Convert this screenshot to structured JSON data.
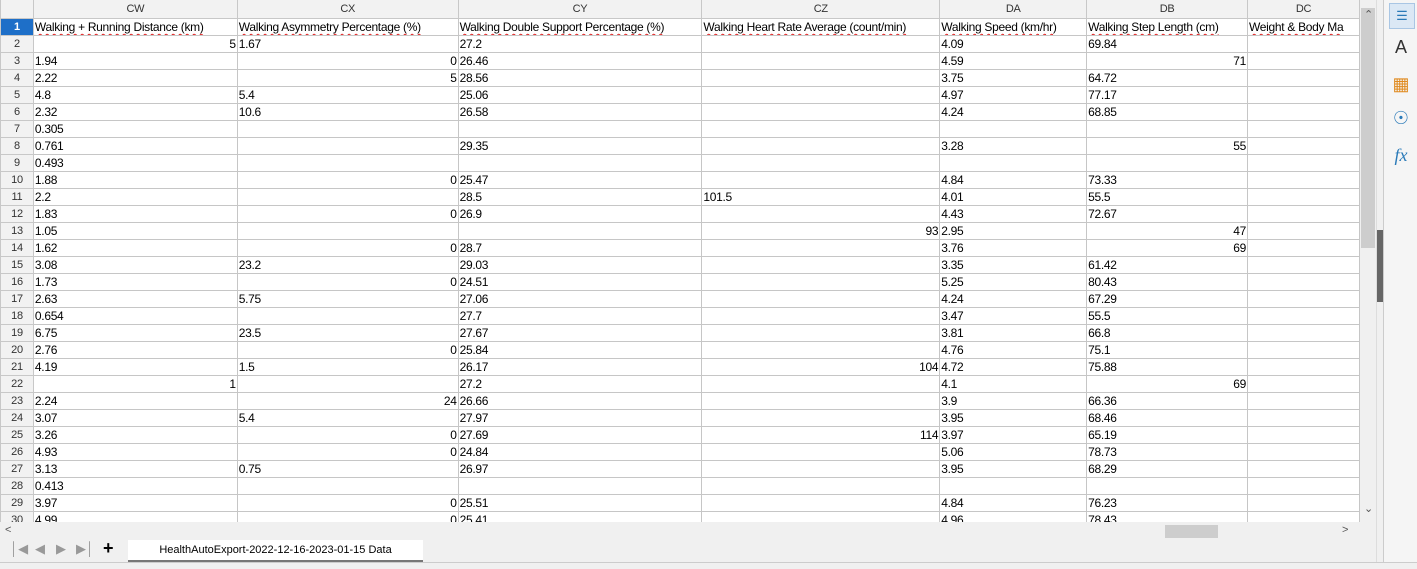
{
  "columns": [
    "CW",
    "CX",
    "CY",
    "CZ",
    "DA",
    "DB",
    "DC"
  ],
  "header_row": [
    "Walking + Running Distance (km)",
    "Walking Asymmetry Percentage (%)",
    "Walking Double Support Percentage (%)",
    "Walking Heart Rate Average (count/min)",
    "Walking Speed (km/hr)",
    "Walking Step Length (cm)",
    "Weight & Body Ma"
  ],
  "rows": [
    [
      5,
      "1.67",
      "27.2",
      "",
      "4.09",
      "69.84",
      ""
    ],
    [
      "1.94",
      0,
      "26.46",
      "",
      "4.59",
      71,
      ""
    ],
    [
      "2.22",
      5,
      "28.56",
      "",
      "3.75",
      "64.72",
      ""
    ],
    [
      "4.8",
      "5.4",
      "25.06",
      "",
      "4.97",
      "77.17",
      ""
    ],
    [
      "2.32",
      "10.6",
      "26.58",
      "",
      "4.24",
      "68.85",
      ""
    ],
    [
      "0.305",
      "",
      "",
      "",
      "",
      "",
      ""
    ],
    [
      "0.761",
      "",
      "29.35",
      "",
      "3.28",
      55,
      ""
    ],
    [
      "0.493",
      "",
      "",
      "",
      "",
      "",
      ""
    ],
    [
      "1.88",
      0,
      "25.47",
      "",
      "4.84",
      "73.33",
      ""
    ],
    [
      "2.2",
      "",
      "28.5",
      "101.5",
      "4.01",
      "55.5",
      ""
    ],
    [
      "1.83",
      0,
      "26.9",
      "",
      "4.43",
      "72.67",
      ""
    ],
    [
      "1.05",
      "",
      "",
      93,
      "2.95",
      47,
      ""
    ],
    [
      "1.62",
      0,
      "28.7",
      "",
      "3.76",
      69,
      ""
    ],
    [
      "3.08",
      "23.2",
      "29.03",
      "",
      "3.35",
      "61.42",
      ""
    ],
    [
      "1.73",
      0,
      "24.51",
      "",
      "5.25",
      "80.43",
      ""
    ],
    [
      "2.63",
      "5.75",
      "27.06",
      "",
      "4.24",
      "67.29",
      ""
    ],
    [
      "0.654",
      "",
      "27.7",
      "",
      "3.47",
      "55.5",
      ""
    ],
    [
      "6.75",
      "23.5",
      "27.67",
      "",
      "3.81",
      "66.8",
      ""
    ],
    [
      "2.76",
      0,
      "25.84",
      "",
      "4.76",
      "75.1",
      ""
    ],
    [
      "4.19",
      "1.5",
      "26.17",
      104,
      "4.72",
      "75.88",
      ""
    ],
    [
      1,
      "",
      "27.2",
      "",
      "4.1",
      69,
      ""
    ],
    [
      "2.24",
      24,
      "26.66",
      "",
      "3.9",
      "66.36",
      ""
    ],
    [
      "3.07",
      "5.4",
      "27.97",
      "",
      "3.95",
      "68.46",
      ""
    ],
    [
      "3.26",
      0,
      "27.69",
      114,
      "3.97",
      "65.19",
      ""
    ],
    [
      "4.93",
      0,
      "24.84",
      "",
      "5.06",
      "78.73",
      ""
    ],
    [
      "3.13",
      "0.75",
      "26.97",
      "",
      "3.95",
      "68.29",
      ""
    ],
    [
      "0.413",
      "",
      "",
      "",
      "",
      "",
      ""
    ],
    [
      "3.97",
      0,
      "25.51",
      "",
      "4.84",
      "76.23",
      ""
    ],
    [
      "4.99",
      0,
      "25.41",
      "",
      "4.96",
      "78.43",
      ""
    ]
  ],
  "sheet_tab": "HealthAutoExport-2022-12-16-2023-01-15 Data",
  "sidebar_icons": [
    "properties-icon",
    "styles-icon",
    "gallery-icon",
    "navigator-icon",
    "functions-icon"
  ],
  "colors": {
    "selected_row_header": "#1e6fc8",
    "accent": "#2a7ab8"
  }
}
